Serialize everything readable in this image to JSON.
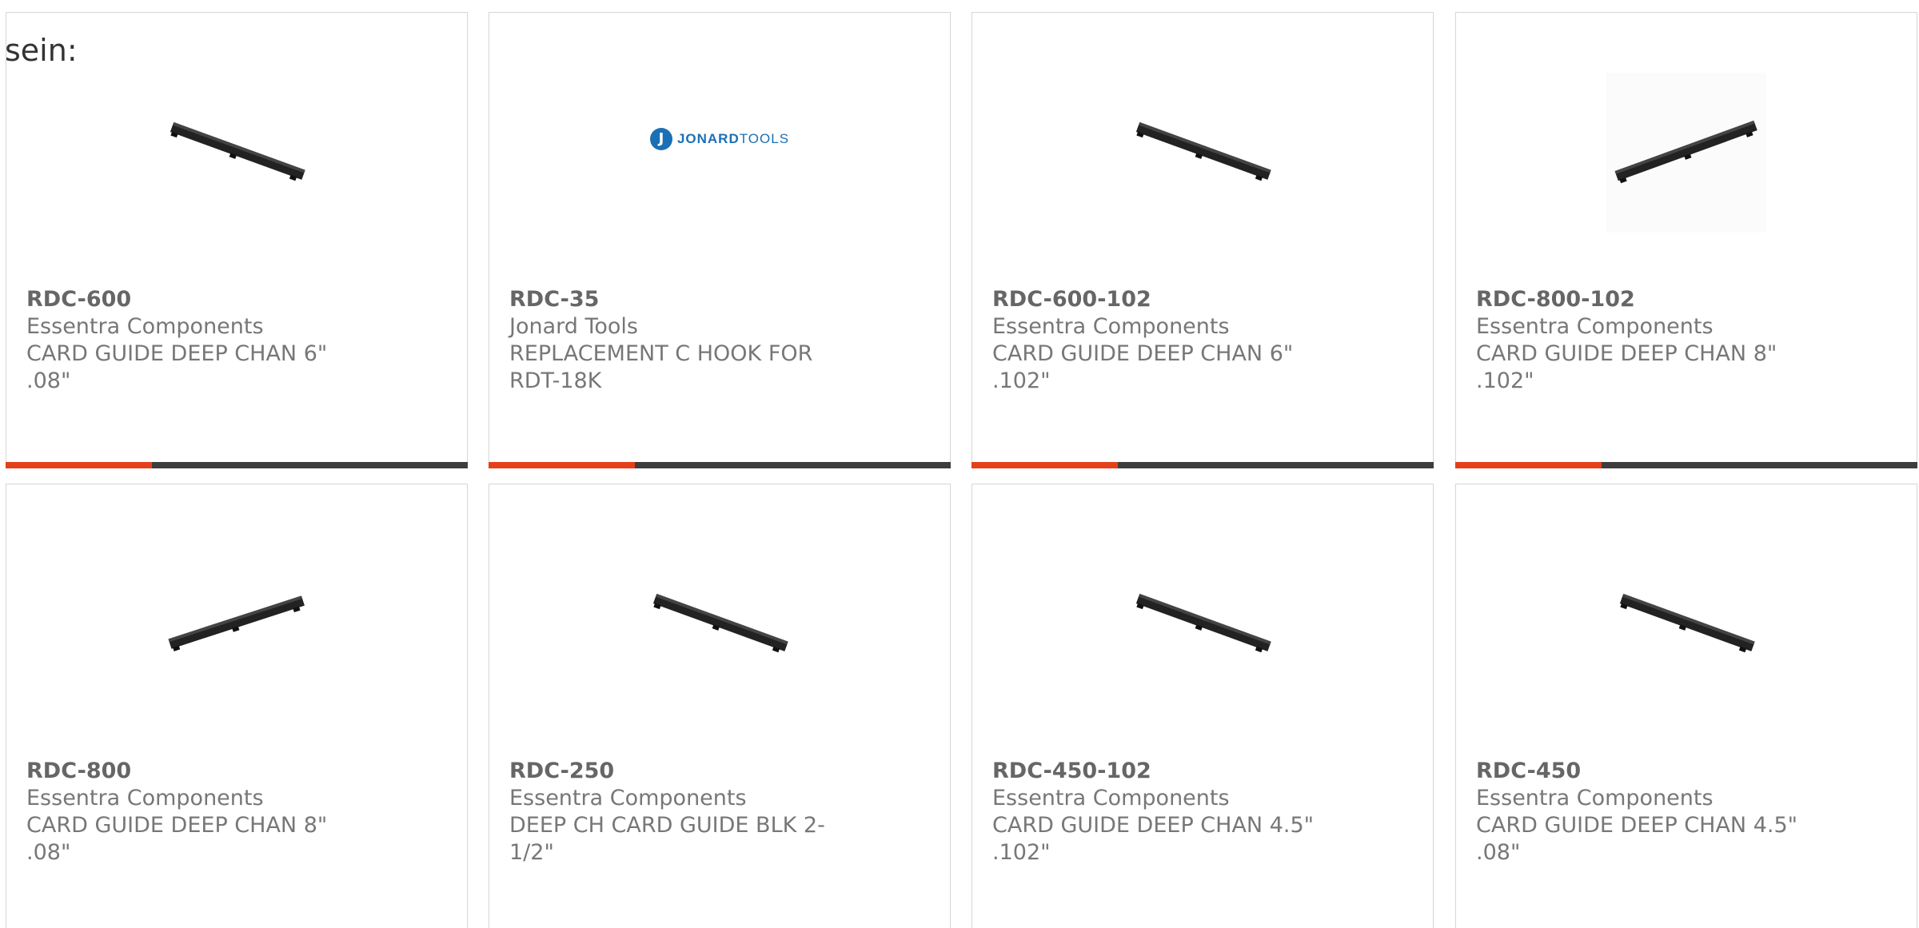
{
  "page": {
    "top_text": "sein:"
  },
  "colors": {
    "accent": "#e5401a",
    "bar": "#3d3d3d",
    "logo_blue": "#1b6fb5"
  },
  "products": [
    {
      "part": "RDC-600",
      "manufacturer": "Essentra Components",
      "description": "CARD GUIDE DEEP CHAN 6\" .08\"",
      "image": "card-guide-rail",
      "orientation": "down"
    },
    {
      "part": "RDC-35",
      "manufacturer": "Jonard Tools",
      "description": "REPLACEMENT C HOOK FOR RDT-18K",
      "image": "jonard-tools-logo",
      "logo": {
        "mark": "J",
        "bold": "JONARD",
        "light": "TOOLS"
      }
    },
    {
      "part": "RDC-600-102",
      "manufacturer": "Essentra Components",
      "description": "CARD GUIDE DEEP CHAN 6\" .102\"",
      "image": "card-guide-rail",
      "orientation": "down"
    },
    {
      "part": "RDC-800-102",
      "manufacturer": "Essentra Components",
      "description": "CARD GUIDE DEEP CHAN 8\" .102\"",
      "image": "card-guide-rail",
      "orientation": "up"
    },
    {
      "part": "RDC-800",
      "manufacturer": "Essentra Components",
      "description": "CARD GUIDE DEEP CHAN 8\" .08\"",
      "image": "card-guide-rail",
      "orientation": "up"
    },
    {
      "part": "RDC-250",
      "manufacturer": "Essentra Components",
      "description": "DEEP CH CARD GUIDE BLK 2-1/2\"",
      "image": "card-guide-rail",
      "orientation": "down"
    },
    {
      "part": "RDC-450-102",
      "manufacturer": "Essentra Components",
      "description": "CARD GUIDE DEEP CHAN 4.5\" .102\"",
      "image": "card-guide-rail",
      "orientation": "down"
    },
    {
      "part": "RDC-450",
      "manufacturer": "Essentra Components",
      "description": "CARD GUIDE DEEP CHAN 4.5\" .08\"",
      "image": "card-guide-rail",
      "orientation": "down"
    }
  ]
}
